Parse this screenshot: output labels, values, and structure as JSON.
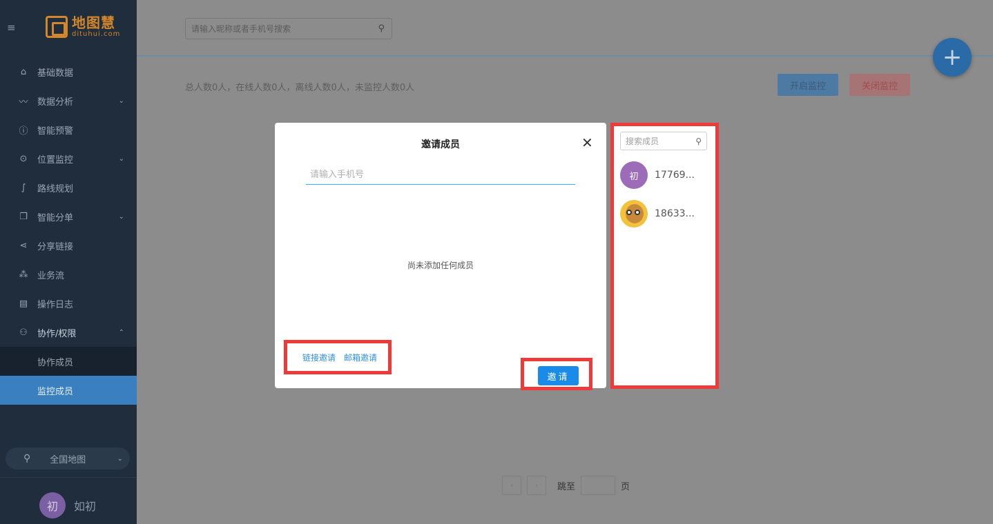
{
  "sidebar": {
    "logo_cn": "地图慧",
    "logo_en": "dituhui.com",
    "menu": [
      {
        "label": "基础数据",
        "icon": "home-icon",
        "caret": false
      },
      {
        "label": "数据分析",
        "icon": "pulse-icon",
        "caret": true
      },
      {
        "label": "智能预警",
        "icon": "info-circle-icon",
        "caret": false
      },
      {
        "label": "位置监控",
        "icon": "location-pin-icon",
        "caret": true
      },
      {
        "label": "路线规划",
        "icon": "route-icon",
        "caret": false
      },
      {
        "label": "智能分单",
        "icon": "copy-icon",
        "caret": true
      },
      {
        "label": "分享链接",
        "icon": "share-icon",
        "caret": false
      },
      {
        "label": "业务流",
        "icon": "workflow-icon",
        "caret": false
      },
      {
        "label": "操作日志",
        "icon": "clipboard-icon",
        "caret": false
      },
      {
        "label": "协作/权限",
        "icon": "user-icon",
        "caret": true
      }
    ],
    "submenu": [
      {
        "label": "协作成员"
      },
      {
        "label": "监控成员"
      }
    ],
    "map_select": "全国地图",
    "user": {
      "avatar_char": "初",
      "name": "如初"
    }
  },
  "topbar": {
    "search_placeholder": "请输入昵称或者手机号搜索"
  },
  "main": {
    "stats": "总人数0人，在线人数0人，离线人数0人，未监控人数0人",
    "btn_start": "开启监控",
    "btn_stop": "关闭监控",
    "pager": {
      "jump_label": "跳至",
      "page_label": "页"
    }
  },
  "modal": {
    "title": "邀请成员",
    "phone_placeholder": "请输入手机号",
    "empty_text": "尚未添加任何成员",
    "link_invite": "链接邀请",
    "email_invite": "邮箱邀请",
    "invite_btn": "邀请"
  },
  "members_panel": {
    "search_placeholder": "搜索成员",
    "members": [
      {
        "avatar_char": "初",
        "name": "17769..."
      },
      {
        "avatar_char": "",
        "name": "18633..."
      }
    ]
  },
  "colors": {
    "highlight": "#ef3a3a",
    "primary": "#1a8be8",
    "sidebar_bg": "#1f2d3d"
  }
}
